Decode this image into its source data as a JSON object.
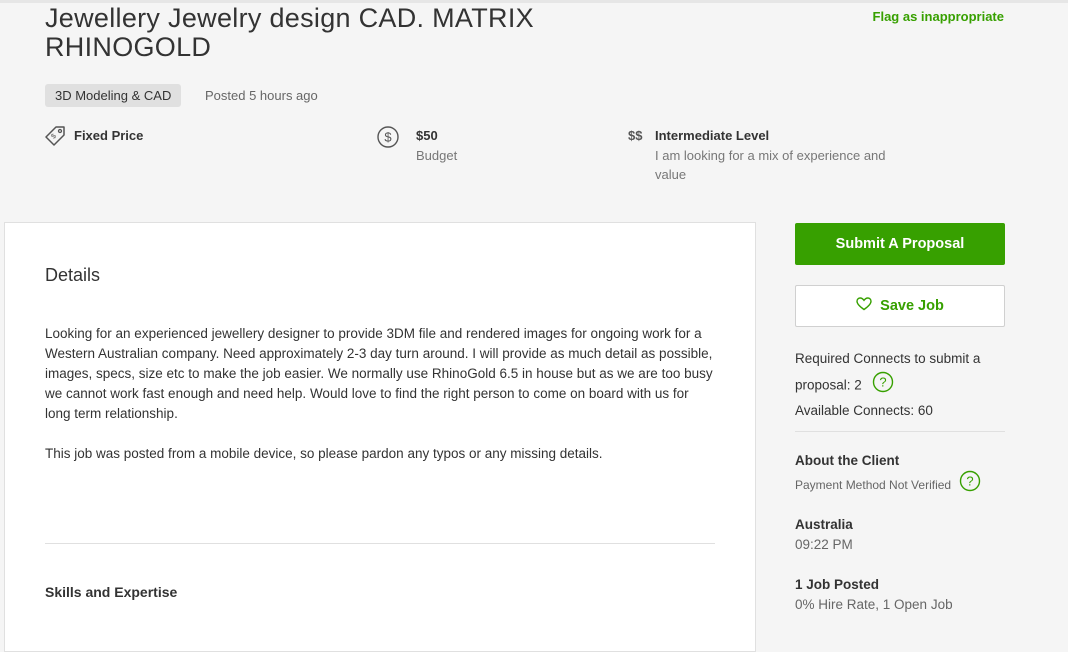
{
  "job": {
    "title": "Jewellery Jewelry design CAD. MATRIX RHINOGOLD",
    "flag_label": "Flag as inappropriate",
    "category": "3D Modeling & CAD",
    "posted": "Posted 5 hours ago",
    "price_type": "Fixed Price",
    "budget_value": "$50",
    "budget_label": "Budget",
    "level_symbol": "$$",
    "level_label": "Intermediate Level",
    "level_desc": "I am looking for a mix of experience and value"
  },
  "details": {
    "title": "Details",
    "description": "Looking for an experienced jewellery designer to provide 3DM file and rendered images for ongoing work for a Western Australian company. Need approximately 2-3 day turn around. I will provide as much detail as possible, images, specs, size etc to make the job easier. We normally use RhinoGold 6.5 in house but as we are too busy we cannot work fast enough and need help. Would love to find the right person to come on board with us for long term relationship.",
    "mobile_note": "This job was posted from a mobile device, so please pardon any typos or any missing details.",
    "skills_title": "Skills and Expertise"
  },
  "sidebar": {
    "submit_label": "Submit A Proposal",
    "save_label": "Save Job",
    "required_connects": "Required Connects to submit a proposal: 2",
    "available_connects": "Available Connects: 60",
    "about_title": "About the Client",
    "payment_status": "Payment Method Not Verified",
    "country": "Australia",
    "local_time": "09:22 PM",
    "jobs_posted": "1 Job Posted",
    "hire_rate": "0% Hire Rate, 1 Open Job"
  },
  "colors": {
    "accent": "#37a000",
    "background": "#f5f5f5"
  }
}
